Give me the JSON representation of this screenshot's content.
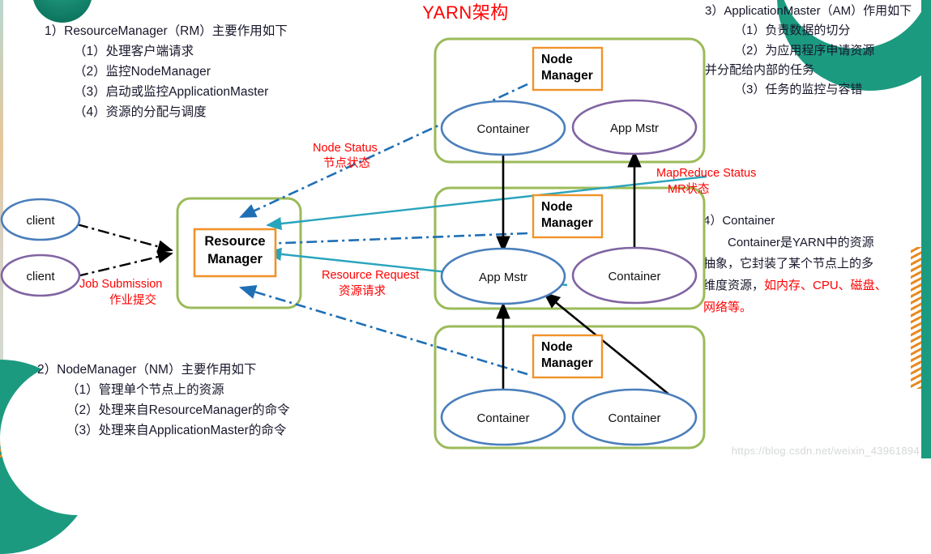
{
  "title": "YARN架构",
  "colors": {
    "title_red": "#ff0000",
    "group_green": "#9bbb59",
    "box_orange": "#f0932b",
    "ellipse_blue": "#4a7ebb",
    "ellipse_purple": "#8064a2",
    "arrow_teal": "#29a4bd",
    "arrow_dashed_blue": "#1f6fb5",
    "deco_teal": "#1c9a80",
    "deco_orange": "#e8891f"
  },
  "text_blocks": {
    "resource_manager": {
      "heading": "1）ResourceManager（RM）主要作用如下",
      "items": [
        "（1）处理客户端请求",
        "（2）监控NodeManager",
        "（3）启动或监控ApplicationMaster",
        "（4）资源的分配与调度"
      ]
    },
    "application_master": {
      "heading": "3）ApplicationMaster（AM）作用如下",
      "items": [
        "（1）负责数据的切分",
        "（2）为应用程序申请资源"
      ],
      "continuation": "并分配给内部的任务",
      "items_after": [
        "（3）任务的监控与容错"
      ]
    },
    "container": {
      "heading": "4）Container",
      "paragraph_line1": "　　Container是YARN中的资源",
      "paragraph_line2": "抽象，它封装了某个节点上的多",
      "paragraph_line3_black": "维度资源，",
      "paragraph_line3_red": "如内存、CPU、磁盘、",
      "paragraph_line4_red": "网络等。"
    },
    "node_manager": {
      "heading": "2）NodeManager（NM）主要作用如下",
      "items": [
        "（1）管理单个节点上的资源",
        "（2）处理来自ResourceManager的命令",
        "（3）处理来自ApplicationMaster的命令"
      ]
    }
  },
  "diagram": {
    "clients": [
      {
        "label": "client",
        "style": "blue"
      },
      {
        "label": "client",
        "style": "purple"
      }
    ],
    "resource_manager_box": {
      "line1": "Resource",
      "line2": "Manager"
    },
    "node_groups": [
      {
        "node_manager_line1": "Node",
        "node_manager_line2": "Manager",
        "left_ellipse": {
          "label": "Container",
          "style": "blue"
        },
        "right_ellipse": {
          "label": "App Mstr",
          "style": "purple"
        }
      },
      {
        "node_manager_line1": "Node",
        "node_manager_line2": "Manager",
        "left_ellipse": {
          "label": "App Mstr",
          "style": "blue"
        },
        "right_ellipse": {
          "label": "Container",
          "style": "purple"
        }
      },
      {
        "node_manager_line1": "Node",
        "node_manager_line2": "Manager",
        "left_ellipse": {
          "label": "Container",
          "style": "blue"
        },
        "right_ellipse": {
          "label": "Container",
          "style": "blue"
        }
      }
    ],
    "edge_labels": {
      "job_submission_en": "Job Submission",
      "job_submission_zh": "作业提交",
      "node_status_en": "Node Status",
      "node_status_zh": "节点状态",
      "resource_request_en": "Resource Request",
      "resource_request_zh": "资源请求",
      "mapreduce_status_en": "MapReduce Status",
      "mapreduce_status_zh": "MR状态"
    }
  },
  "watermark": "https://blog.csdn.net/weixin_43961894"
}
